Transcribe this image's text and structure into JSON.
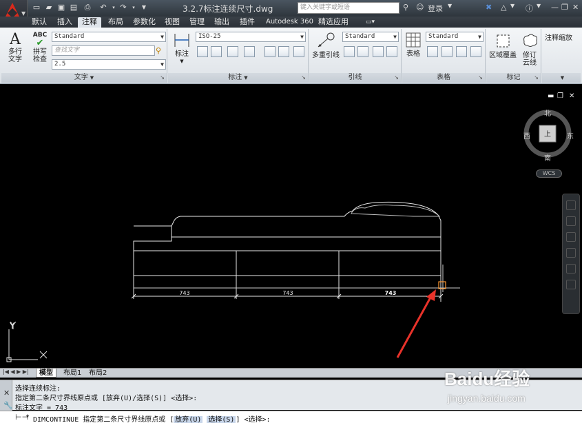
{
  "titlebar": {
    "title": "3.2.7标注连续尺寸.dwg",
    "search_placeholder": "键入关键字或短语",
    "login": "登录"
  },
  "tabs": [
    "默认",
    "插入",
    "注释",
    "布局",
    "参数化",
    "视图",
    "管理",
    "输出",
    "插件",
    "Autodesk 360",
    "精选应用"
  ],
  "ribbon": {
    "text_panel": {
      "title": "文字",
      "multiline_text": "多行\n文字",
      "spellcheck": "拼写\n检查",
      "style_value": "Standard",
      "find_placeholder": "查找文字",
      "height_value": "2.5"
    },
    "dim_panel": {
      "title": "标注",
      "dim_button": "标注",
      "style_value": "ISO-25"
    },
    "leader_panel": {
      "title": "引线",
      "multileader": "多重引线",
      "style_value": "Standard"
    },
    "table_panel": {
      "title": "表格",
      "table_button": "表格",
      "style_value": "Standard"
    },
    "markup_panel": {
      "title": "标记",
      "wipeout": "区域覆盖",
      "revcloud": "修订\n云线"
    },
    "scale_panel": {
      "title": "注释缩放"
    }
  },
  "viewcube": {
    "north": "北",
    "south": "南",
    "west": "西",
    "east": "东",
    "center": "上",
    "wcs": "WCS"
  },
  "drawing": {
    "dims": [
      "743",
      "743",
      "743"
    ],
    "ucs_x": "X",
    "ucs_y": "Y"
  },
  "layout_tabs": [
    "模型",
    "布局1",
    "布局2"
  ],
  "command": {
    "history": [
      "选择连续标注:",
      "指定第二条尺寸界线原点或 [放弃(U)/选择(S)] <选择>:",
      "标注文字 = 743"
    ],
    "input_prefix": "DIMCONTINUE 指定第二条尺寸界线原点或 [",
    "opt_undo": "放弃(U)",
    "opt_select": "选择(S)",
    "input_suffix": "] <选择>:"
  },
  "watermark": {
    "brand": "Baidu经验",
    "url": "jingyan.baidu.com"
  },
  "colors": {
    "accent_red": "#e8322a",
    "canvas": "#000000",
    "ribbon": "#e6eaee"
  }
}
